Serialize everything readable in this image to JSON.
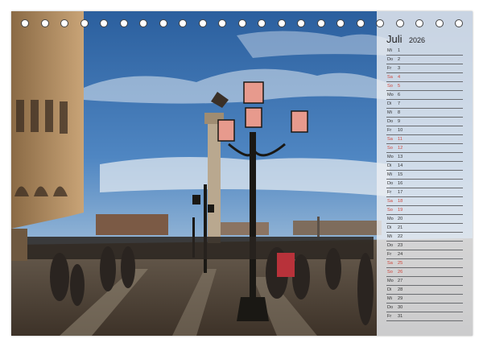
{
  "calendar": {
    "month": "Juli",
    "year": "2026",
    "days": [
      {
        "wd": "Mi",
        "d": "1",
        "weekend": false
      },
      {
        "wd": "Do",
        "d": "2",
        "weekend": false
      },
      {
        "wd": "Fr",
        "d": "3",
        "weekend": false
      },
      {
        "wd": "Sa",
        "d": "4",
        "weekend": true
      },
      {
        "wd": "So",
        "d": "5",
        "weekend": true
      },
      {
        "wd": "Mo",
        "d": "6",
        "weekend": false
      },
      {
        "wd": "Di",
        "d": "7",
        "weekend": false
      },
      {
        "wd": "Mi",
        "d": "8",
        "weekend": false
      },
      {
        "wd": "Do",
        "d": "9",
        "weekend": false
      },
      {
        "wd": "Fr",
        "d": "10",
        "weekend": false
      },
      {
        "wd": "Sa",
        "d": "11",
        "weekend": true
      },
      {
        "wd": "So",
        "d": "12",
        "weekend": true
      },
      {
        "wd": "Mo",
        "d": "13",
        "weekend": false
      },
      {
        "wd": "Di",
        "d": "14",
        "weekend": false
      },
      {
        "wd": "Mi",
        "d": "15",
        "weekend": false
      },
      {
        "wd": "Do",
        "d": "16",
        "weekend": false
      },
      {
        "wd": "Fr",
        "d": "17",
        "weekend": false
      },
      {
        "wd": "Sa",
        "d": "18",
        "weekend": true
      },
      {
        "wd": "So",
        "d": "19",
        "weekend": true
      },
      {
        "wd": "Mo",
        "d": "20",
        "weekend": false
      },
      {
        "wd": "Di",
        "d": "21",
        "weekend": false
      },
      {
        "wd": "Mi",
        "d": "22",
        "weekend": false
      },
      {
        "wd": "Do",
        "d": "23",
        "weekend": false
      },
      {
        "wd": "Fr",
        "d": "24",
        "weekend": false
      },
      {
        "wd": "Sa",
        "d": "25",
        "weekend": true
      },
      {
        "wd": "So",
        "d": "26",
        "weekend": true
      },
      {
        "wd": "Mo",
        "d": "27",
        "weekend": false
      },
      {
        "wd": "Di",
        "d": "28",
        "weekend": false
      },
      {
        "wd": "Mi",
        "d": "29",
        "weekend": false
      },
      {
        "wd": "Do",
        "d": "30",
        "weekend": false
      },
      {
        "wd": "Fr",
        "d": "31",
        "weekend": false
      }
    ]
  },
  "colors": {
    "weekend": "#d0453a",
    "weekday": "#333333",
    "panel": "#eceef1"
  },
  "binding": {
    "ring_count": 23
  }
}
